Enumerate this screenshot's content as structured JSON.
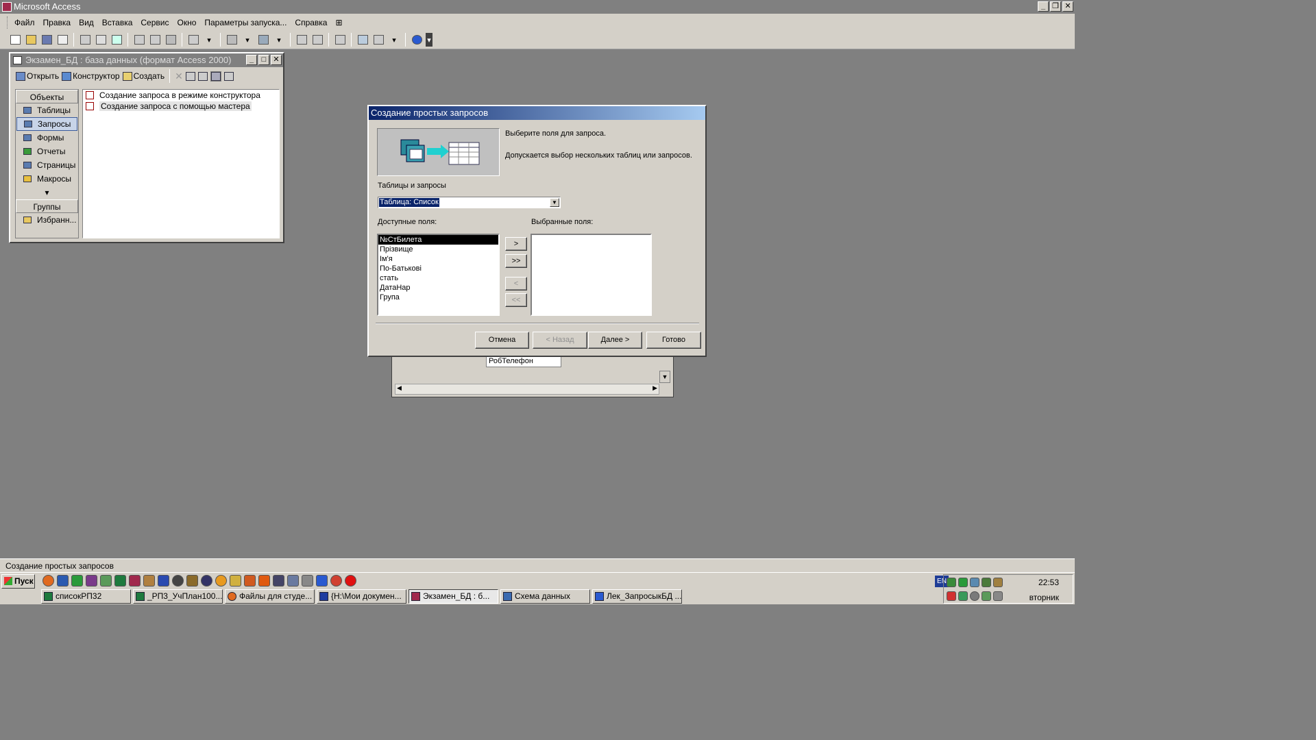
{
  "app": {
    "title": "Microsoft Access"
  },
  "menu": [
    "Файл",
    "Правка",
    "Вид",
    "Вставка",
    "Сервис",
    "Окно",
    "Параметры запуска...",
    "Справка"
  ],
  "db_window": {
    "title": "Экзамен_БД : база данных (формат Access 2000)",
    "toolbar": {
      "open": "Открыть",
      "design": "Конструктор",
      "create": "Создать"
    },
    "objects_header": "Объекты",
    "objects": [
      "Таблицы",
      "Запросы",
      "Формы",
      "Отчеты",
      "Страницы",
      "Макросы"
    ],
    "selected_object": "Запросы",
    "groups_header": "Группы",
    "groups": [
      "Избранн..."
    ],
    "items": [
      "Создание запроса в режиме конструктора",
      "Создание запроса с помощью мастера"
    ]
  },
  "behind_window": {
    "field": "РобТелефон"
  },
  "dialog": {
    "title": "Создание простых запросов",
    "instruction1": "Выберите поля для запроса.",
    "instruction2": "Допускается выбор нескольких таблиц или запросов.",
    "tables_label": "Таблицы и запросы",
    "tables_value": "Таблица: Список",
    "available_label": "Доступные поля:",
    "selected_label": "Выбранные поля:",
    "available_fields": [
      "№СтБилета",
      "Прізвище",
      "Ім'я",
      "По-Батькові",
      "стать",
      "ДатаНар",
      "Група"
    ],
    "move_one": ">",
    "move_all": ">>",
    "remove_one": "<",
    "remove_all": "<<",
    "cancel": "Отмена",
    "back": "< Назад",
    "next": "Далее >",
    "finish": "Готово"
  },
  "status": "Создание простых запросов",
  "taskbar": {
    "start": "Пуск",
    "tasks": [
      "списокРП32",
      "_РП3_УчПлан100...",
      "Файлы для студе...",
      "{H:\\Мои докумен...",
      "Экзамен_БД : б...",
      "Схема данных",
      "Лек_ЗапросыкБД ..."
    ],
    "active_task": "Экзамен_БД : б...",
    "lang": "EN",
    "time": "22:53",
    "day": "вторник"
  }
}
